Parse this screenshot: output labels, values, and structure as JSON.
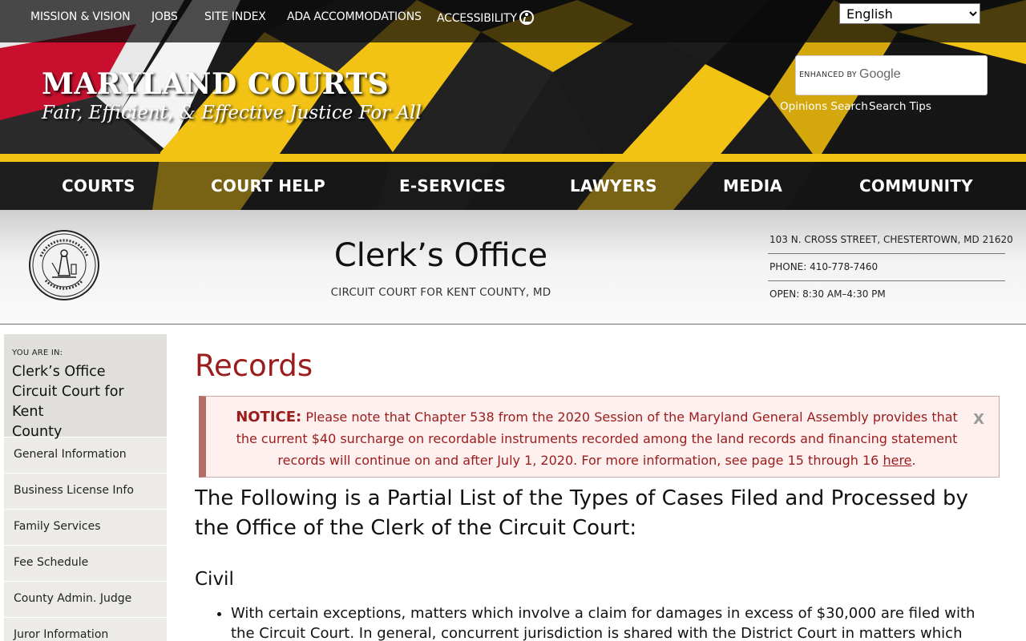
{
  "topbar": {
    "links": [
      "MISSION & VISION",
      "JOBS",
      "SITE INDEX",
      "ADA ACCOMMODATIONS"
    ],
    "accessibility_label": "ACCESSIBILITY",
    "language": {
      "selected": "English"
    }
  },
  "brand": {
    "title": "MARYLAND COURTS",
    "tagline": "Fair, Efficient, & Effective Justice For All"
  },
  "search": {
    "enhanced_label": "ENHANCED BY",
    "provider": "Google",
    "links": [
      "Opinions Search",
      "Search Tips"
    ]
  },
  "mainnav": {
    "items": [
      "COURTS",
      "COURT HELP",
      "E-SERVICES",
      "LAWYERS",
      "MEDIA",
      "COMMUNITY"
    ]
  },
  "office": {
    "title": "Clerk’s Office",
    "subtitle": "CIRCUIT COURT FOR KENT COUNTY, MD",
    "address": "103 N. CROSS STREET, CHESTERTOWN, MD 21620",
    "phone": "PHONE: 410-778-7460",
    "hours": "OPEN: 8:30 AM–4:30 PM"
  },
  "sidebar": {
    "you_are_in_label": "YOU ARE IN:",
    "location_lines": [
      "Clerk’s Office",
      "Circuit Court for Kent",
      "County"
    ],
    "items": [
      "General Information",
      "Business License Info",
      "Family Services",
      "Fee Schedule",
      "County Admin. Judge",
      "Juror Information"
    ]
  },
  "main": {
    "heading": "Records",
    "notice": {
      "label": "NOTICE:",
      "text": "Please note that Chapter 538 from the 2020 Session of the Maryland General Assembly provides that the current $40 surcharge on recordable instruments recorded among the land records and financing statement records will continue on and after July 1, 2020. For more information, see page 15 through 16",
      "link_text": "here",
      "after_link": ".",
      "close": "X"
    },
    "lead": "The Following is a Partial List of the Types of Cases Filed and Processed by the Office of the Clerk of the Circuit Court:",
    "section": "Civil",
    "bullets": [
      "With certain exceptions, matters which involve a claim for damages in excess of $30,000 are filed with the Circuit Court. In general, concurrent jurisdiction is shared with the District Court in matters which involve a claim for an"
    ]
  },
  "colors": {
    "flag_gold": "#f2c315",
    "flag_red": "#c8102e",
    "heading_red": "#9b1c1c",
    "notice_bg": "#fdf0ee",
    "notice_bar": "#b46c64"
  }
}
